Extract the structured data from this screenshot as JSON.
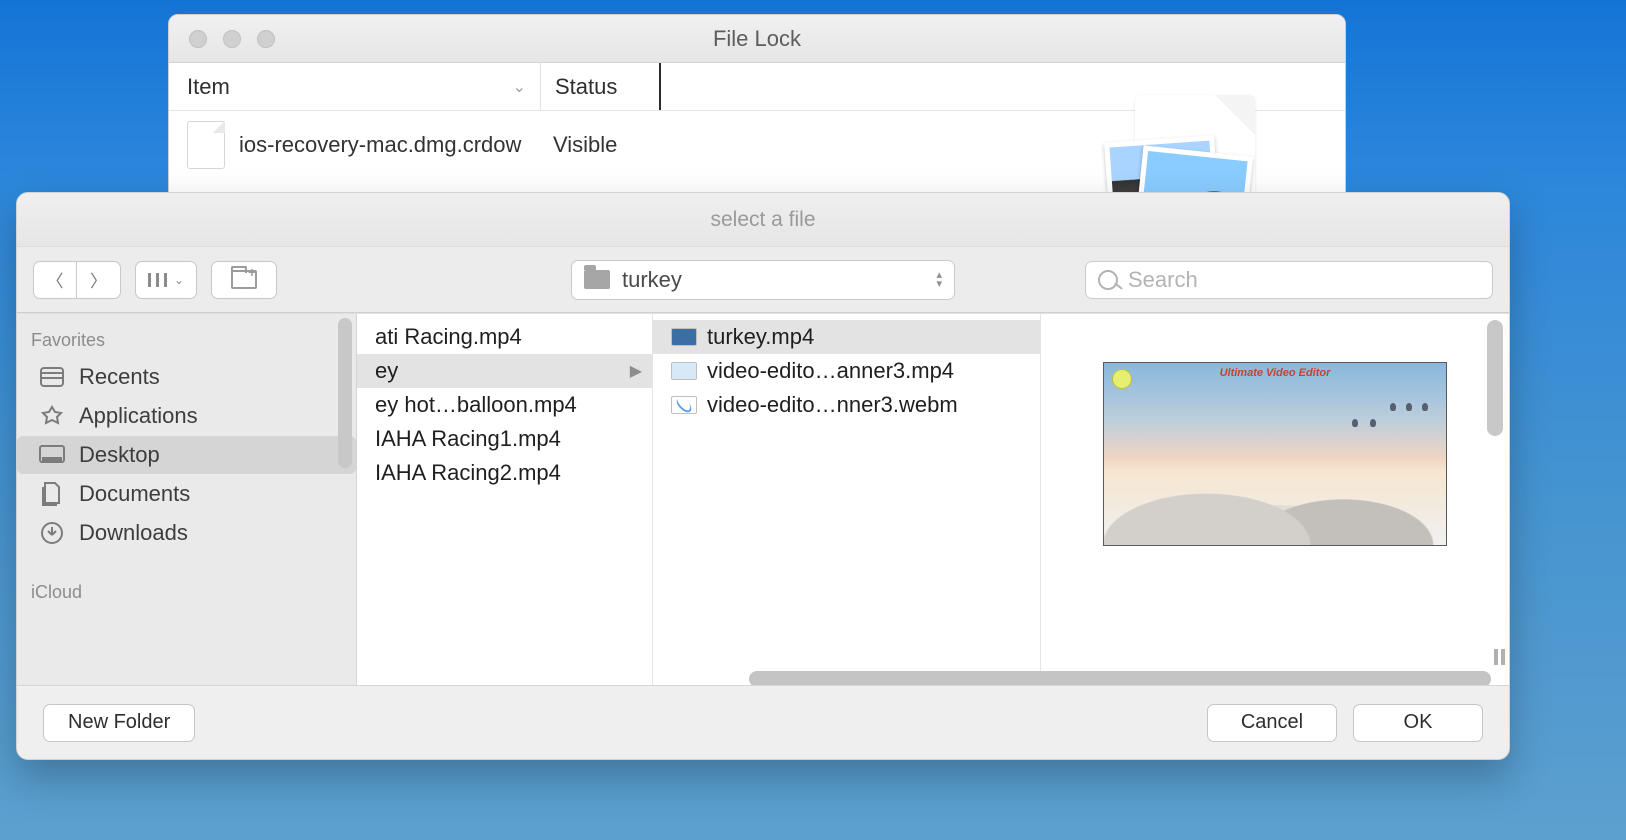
{
  "parent_window": {
    "title": "File Lock",
    "columns": {
      "item": "Item",
      "status": "Status"
    },
    "row": {
      "filename": "ios-recovery-mac.dmg.crdow",
      "status": "Visible"
    }
  },
  "sheet": {
    "title": "select a file",
    "path_current": "turkey",
    "search_placeholder": "Search",
    "sidebar": {
      "group1_head": "Favorites",
      "group2_head": "iCloud",
      "items": [
        {
          "label": "Recents",
          "active": false
        },
        {
          "label": "Applications",
          "active": false
        },
        {
          "label": "Desktop",
          "active": true
        },
        {
          "label": "Documents",
          "active": false
        },
        {
          "label": "Downloads",
          "active": false
        }
      ]
    },
    "column1": [
      {
        "label": "ati Racing.mp4"
      },
      {
        "label": "ey",
        "selected": true,
        "has_children": true
      },
      {
        "label": "ey hot…balloon.mp4"
      },
      {
        "label": "IAHA Racing1.mp4"
      },
      {
        "label": "IAHA Racing2.mp4"
      }
    ],
    "column2": [
      {
        "label": "turkey.mp4",
        "selected": true,
        "thumb": "dark"
      },
      {
        "label": "video-edito…anner3.mp4",
        "thumb": "light"
      },
      {
        "label": "video-edito…nner3.webm",
        "thumb": "blank"
      }
    ],
    "preview_overlay_text": "Ultimate Video Editor",
    "footer": {
      "new_folder": "New Folder",
      "cancel": "Cancel",
      "ok": "OK"
    }
  }
}
